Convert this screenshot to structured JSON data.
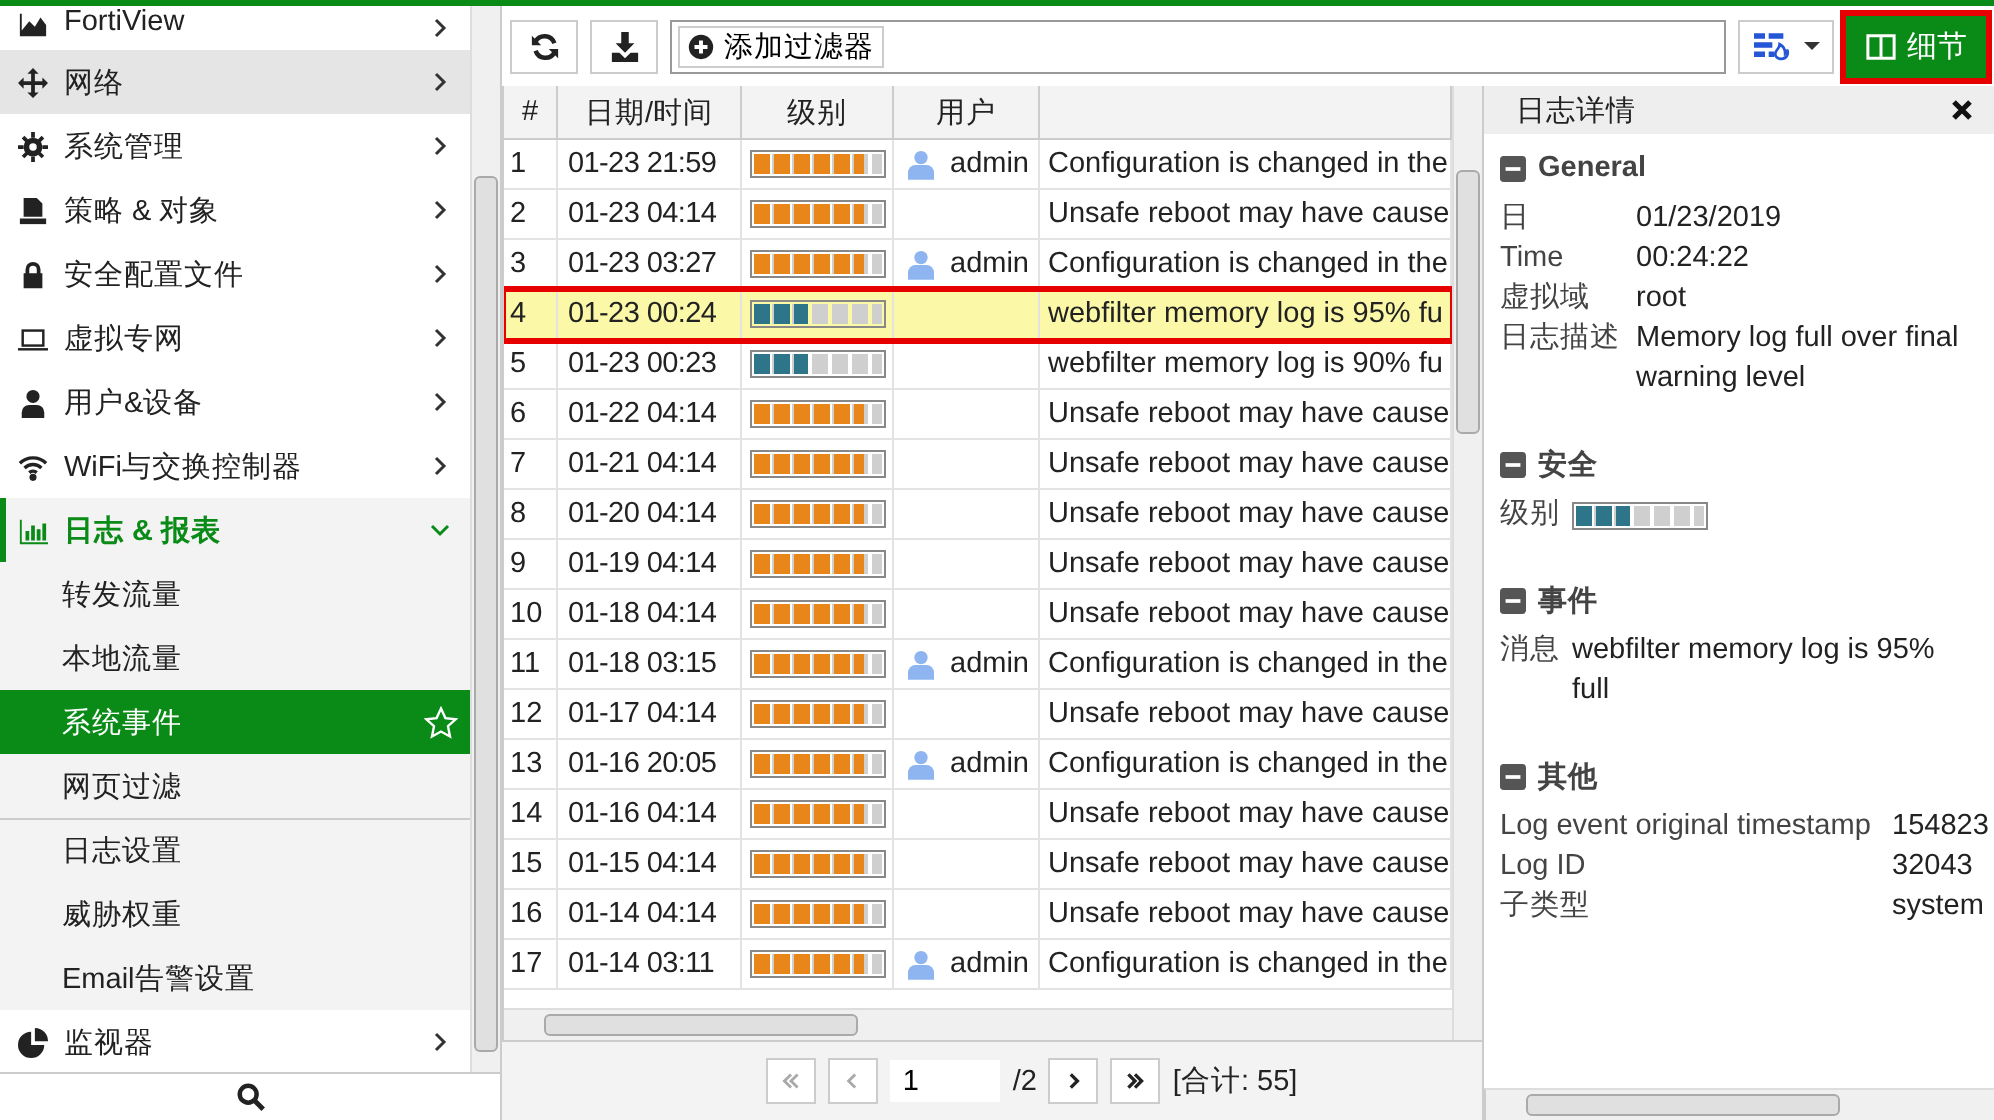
{
  "sidebar": {
    "items": [
      {
        "label": "FortiView",
        "highlighted": false,
        "expanded": false
      },
      {
        "label": "网络",
        "highlighted": true,
        "expanded": false
      },
      {
        "label": "系统管理",
        "highlighted": false,
        "expanded": false
      },
      {
        "label": "策略 & 对象",
        "highlighted": false,
        "expanded": false
      },
      {
        "label": "安全配置文件",
        "highlighted": false,
        "expanded": false
      },
      {
        "label": "虚拟专网",
        "highlighted": false,
        "expanded": false
      },
      {
        "label": "用户&设备",
        "highlighted": false,
        "expanded": false
      },
      {
        "label": "WiFi与交换控制器",
        "highlighted": false,
        "expanded": false
      },
      {
        "label": "日志 & 报表",
        "highlighted": false,
        "expanded": true,
        "children": [
          {
            "label": "转发流量",
            "selected": false,
            "divider_before": false
          },
          {
            "label": "本地流量",
            "selected": false,
            "divider_before": false
          },
          {
            "label": "系统事件",
            "selected": true,
            "divider_before": false
          },
          {
            "label": "网页过滤",
            "selected": false,
            "divider_before": false
          },
          {
            "label": "日志设置",
            "selected": false,
            "divider_before": true
          },
          {
            "label": "威胁权重",
            "selected": false,
            "divider_before": false
          },
          {
            "label": "Email告警设置",
            "selected": false,
            "divider_before": false
          }
        ]
      },
      {
        "label": "监视器",
        "highlighted": false,
        "expanded": false
      }
    ]
  },
  "toolbar": {
    "filter_button": "添加过滤器",
    "details_button": {
      "label": "细节",
      "annotated": true
    }
  },
  "table": {
    "columns": [
      "#",
      "日期/时间",
      "级别",
      "用户"
    ],
    "rows": [
      {
        "num": "1",
        "time": "01-23 21:59",
        "level": 0.857,
        "color": "#e8861a",
        "user": "admin",
        "message": "Configuration is changed in the",
        "selected": false
      },
      {
        "num": "2",
        "time": "01-23 04:14",
        "level": 0.857,
        "color": "#e8861a",
        "message": "Unsafe reboot may have cause",
        "selected": false
      },
      {
        "num": "3",
        "time": "01-23 03:27",
        "level": 0.857,
        "color": "#e8861a",
        "user": "admin",
        "message": "Configuration is changed in the",
        "selected": false
      },
      {
        "num": "4",
        "time": "01-23 00:24",
        "level": 0.429,
        "color": "#2f7589",
        "message": "webfilter memory log is 95% fu",
        "selected": true
      },
      {
        "num": "5",
        "time": "01-23 00:23",
        "level": 0.429,
        "color": "#2f7589",
        "message": "webfilter memory log is 90% fu",
        "selected": false
      },
      {
        "num": "6",
        "time": "01-22 04:14",
        "level": 0.857,
        "color": "#e8861a",
        "message": "Unsafe reboot may have cause",
        "selected": false
      },
      {
        "num": "7",
        "time": "01-21 04:14",
        "level": 0.857,
        "color": "#e8861a",
        "message": "Unsafe reboot may have cause",
        "selected": false
      },
      {
        "num": "8",
        "time": "01-20 04:14",
        "level": 0.857,
        "color": "#e8861a",
        "message": "Unsafe reboot may have cause",
        "selected": false
      },
      {
        "num": "9",
        "time": "01-19 04:14",
        "level": 0.857,
        "color": "#e8861a",
        "message": "Unsafe reboot may have cause",
        "selected": false
      },
      {
        "num": "10",
        "time": "01-18 04:14",
        "level": 0.857,
        "color": "#e8861a",
        "message": "Unsafe reboot may have cause",
        "selected": false
      },
      {
        "num": "11",
        "time": "01-18 03:15",
        "level": 0.857,
        "color": "#e8861a",
        "user": "admin",
        "message": "Configuration is changed in the",
        "selected": false
      },
      {
        "num": "12",
        "time": "01-17 04:14",
        "level": 0.857,
        "color": "#e8861a",
        "message": "Unsafe reboot may have cause",
        "selected": false
      },
      {
        "num": "13",
        "time": "01-16 20:05",
        "level": 0.857,
        "color": "#e8861a",
        "user": "admin",
        "message": "Configuration is changed in the",
        "selected": false
      },
      {
        "num": "14",
        "time": "01-16 04:14",
        "level": 0.857,
        "color": "#e8861a",
        "message": "Unsafe reboot may have cause",
        "selected": false
      },
      {
        "num": "15",
        "time": "01-15 04:14",
        "level": 0.857,
        "color": "#e8861a",
        "message": "Unsafe reboot may have cause",
        "selected": false
      },
      {
        "num": "16",
        "time": "01-14 04:14",
        "level": 0.857,
        "color": "#e8861a",
        "message": "Unsafe reboot may have cause",
        "selected": false
      },
      {
        "num": "17",
        "time": "01-14 03:11",
        "level": 0.857,
        "color": "#e8861a",
        "user": "admin",
        "message": "Configuration is changed in the",
        "selected": false
      }
    ]
  },
  "pagination": {
    "page": "1",
    "total": "/2",
    "count": "[合计: 55]"
  },
  "details": {
    "title": "日志详情",
    "sections": [
      {
        "title": "General",
        "fields": [
          {
            "kind": "text",
            "label": "日",
            "value": "01/23/2019"
          },
          {
            "kind": "text",
            "label": "Time",
            "value": "00:24:22"
          },
          {
            "kind": "text",
            "label": "虚拟域",
            "value": "root"
          },
          {
            "kind": "text",
            "label": "日志描述",
            "value": "Memory log full over final warning level"
          }
        ]
      },
      {
        "title": "安全",
        "fields": [
          {
            "kind": "level",
            "label": "级别",
            "level": 0.429,
            "color": "#2f7589"
          }
        ]
      },
      {
        "title": "事件",
        "fields": [
          {
            "kind": "text",
            "label": "消息",
            "value": "webfilter memory log is 95% full"
          }
        ]
      },
      {
        "title": "其他",
        "fields": [
          {
            "kind": "text",
            "label": "Log event original timestamp",
            "value": "154823"
          },
          {
            "kind": "text",
            "label": "Log ID",
            "value": "32043"
          },
          {
            "kind": "text",
            "label": "子类型",
            "value": "system"
          }
        ]
      }
    ]
  }
}
